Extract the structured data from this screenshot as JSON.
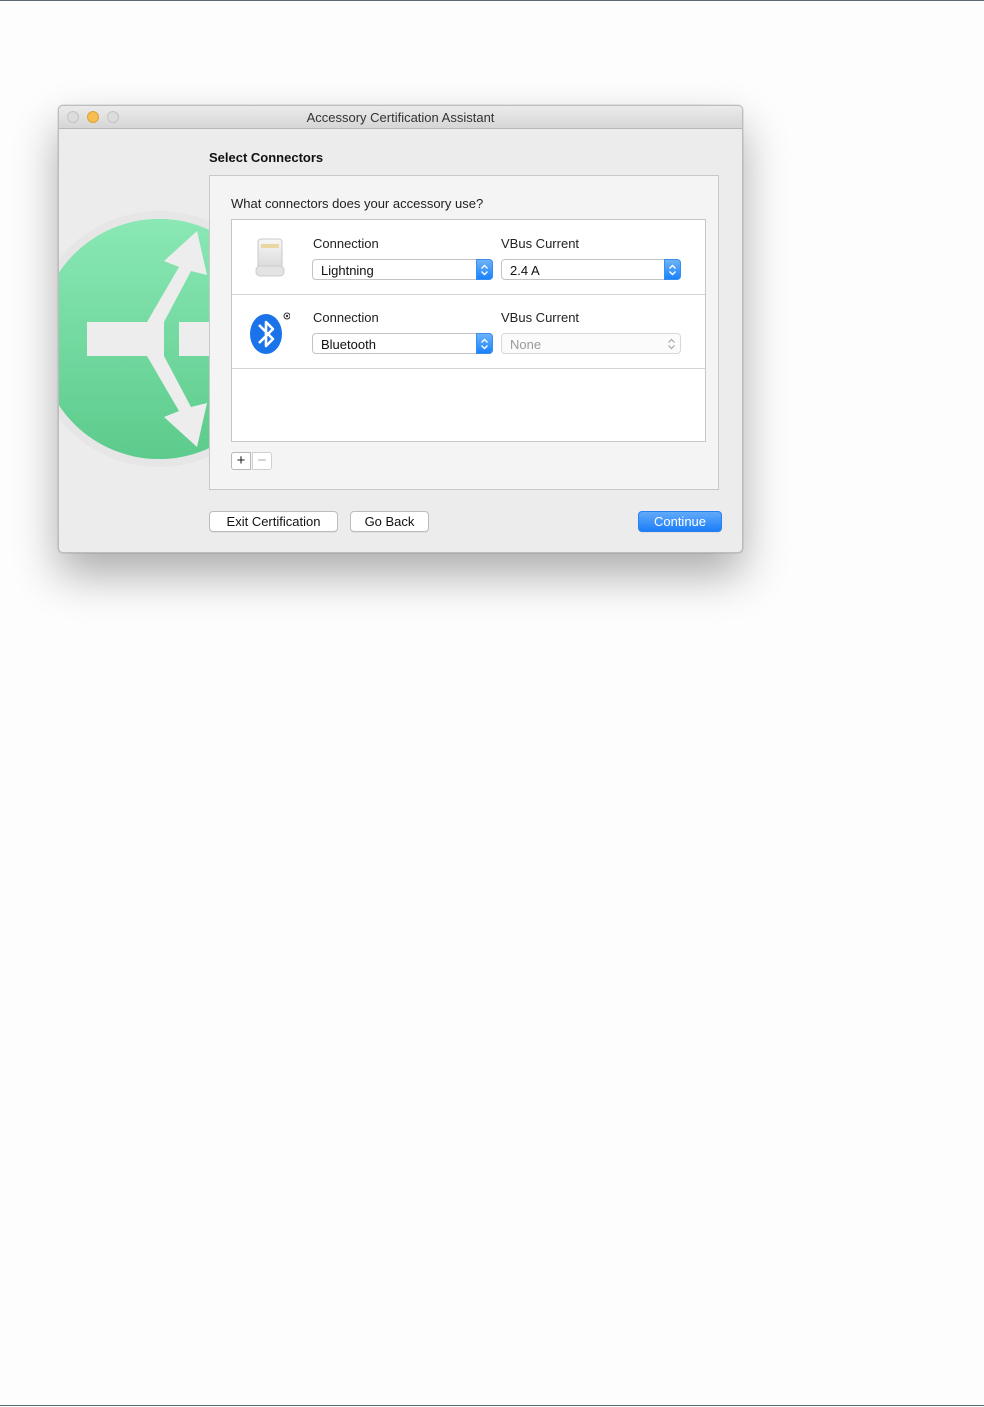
{
  "window": {
    "title": "Accessory Certification Assistant"
  },
  "page": {
    "heading": "Select Connectors",
    "question": "What connectors does your accessory use?"
  },
  "connectors": [
    {
      "icon": "lightning-connector-icon",
      "connection_label": "Connection",
      "connection_value": "Lightning",
      "vbus_label": "VBus Current",
      "vbus_value": "2.4 A",
      "vbus_enabled": true
    },
    {
      "icon": "bluetooth-icon",
      "connection_label": "Connection",
      "connection_value": "Bluetooth",
      "vbus_label": "VBus Current",
      "vbus_value": "None",
      "vbus_enabled": false
    }
  ],
  "list_controls": {
    "add": "+",
    "remove": "−"
  },
  "footer": {
    "exit": "Exit Certification",
    "back": "Go Back",
    "continue": "Continue"
  },
  "colors": {
    "accent": "#1c7ef9",
    "hero_green": "#6fdc9f",
    "bluetooth_blue": "#1a73e8",
    "minimize_yellow": "#f6be50"
  }
}
